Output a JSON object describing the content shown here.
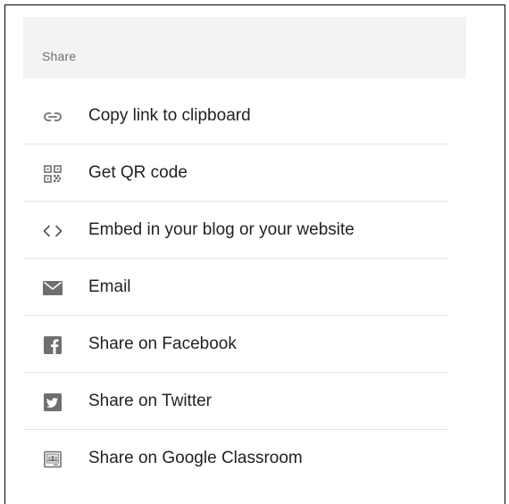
{
  "header": {
    "title": "Share"
  },
  "menu": {
    "items": [
      {
        "label": "Copy link to clipboard",
        "icon": "link-icon"
      },
      {
        "label": "Get QR code",
        "icon": "qr-code-icon"
      },
      {
        "label": "Embed in your blog or your website",
        "icon": "code-embed-icon"
      },
      {
        "label": "Email",
        "icon": "envelope-icon"
      },
      {
        "label": "Share on Facebook",
        "icon": "facebook-icon"
      },
      {
        "label": "Share on Twitter",
        "icon": "twitter-icon"
      },
      {
        "label": "Share on Google Classroom",
        "icon": "google-classroom-icon"
      }
    ]
  },
  "colors": {
    "header_bg": "#f3f3f3",
    "icon": "#6f6f6f",
    "text": "#222222",
    "divider": "#e3e3e3"
  }
}
